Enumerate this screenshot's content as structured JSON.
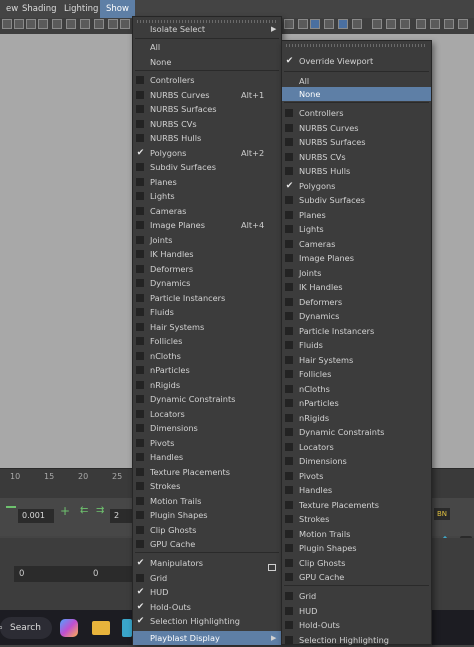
{
  "menubar": {
    "items": [
      "ew",
      "Shading",
      "Lighting",
      "Show"
    ]
  },
  "timeline": {
    "ticks": [
      "10",
      "15",
      "20",
      "25"
    ]
  },
  "range": {
    "step_value": "0.001",
    "frame_value": "2",
    "start_value": "0",
    "end_value": "0",
    "bn_label": "BN"
  },
  "taskbar": {
    "search_label": "Search"
  },
  "show_menu": {
    "header_item": "Isolate Select",
    "items": [
      {
        "label": "All"
      },
      {
        "label": "None"
      },
      {
        "label": "Controllers",
        "checked": false
      },
      {
        "label": "NURBS Curves",
        "accel": "Alt+1",
        "checked": false
      },
      {
        "label": "NURBS Surfaces",
        "checked": false
      },
      {
        "label": "NURBS CVs",
        "checked": false
      },
      {
        "label": "NURBS Hulls",
        "checked": false
      },
      {
        "label": "Polygons",
        "accel": "Alt+2",
        "checked": true
      },
      {
        "label": "Subdiv Surfaces",
        "checked": false
      },
      {
        "label": "Planes",
        "checked": false
      },
      {
        "label": "Lights",
        "checked": false
      },
      {
        "label": "Cameras",
        "checked": false
      },
      {
        "label": "Image Planes",
        "accel": "Alt+4",
        "checked": false
      },
      {
        "label": "Joints",
        "checked": false
      },
      {
        "label": "IK Handles",
        "checked": false
      },
      {
        "label": "Deformers",
        "checked": false
      },
      {
        "label": "Dynamics",
        "checked": false
      },
      {
        "label": "Particle Instancers",
        "checked": false
      },
      {
        "label": "Fluids",
        "checked": false
      },
      {
        "label": "Hair Systems",
        "checked": false
      },
      {
        "label": "Follicles",
        "checked": false
      },
      {
        "label": "nCloths",
        "checked": false
      },
      {
        "label": "nParticles",
        "checked": false
      },
      {
        "label": "nRigids",
        "checked": false
      },
      {
        "label": "Dynamic Constraints",
        "checked": false
      },
      {
        "label": "Locators",
        "checked": false
      },
      {
        "label": "Dimensions",
        "checked": false
      },
      {
        "label": "Pivots",
        "checked": false
      },
      {
        "label": "Handles",
        "checked": false
      },
      {
        "label": "Texture Placements",
        "checked": false
      },
      {
        "label": "Strokes",
        "checked": false
      },
      {
        "label": "Motion Trails",
        "checked": false
      },
      {
        "label": "Plugin Shapes",
        "checked": false
      },
      {
        "label": "Clip Ghosts",
        "checked": false
      },
      {
        "label": "GPU Cache",
        "checked": false
      },
      {
        "label": "Manipulators",
        "checked": true
      },
      {
        "label": "Grid",
        "checked": false
      },
      {
        "label": "HUD",
        "checked": true
      },
      {
        "label": "Hold-Outs",
        "checked": true
      },
      {
        "label": "Selection Highlighting",
        "checked": true
      }
    ],
    "footer_item": "Playblast Display"
  },
  "playblast_menu": {
    "header_item": {
      "label": "Override Viewport",
      "checked": true
    },
    "items": [
      {
        "label": "All"
      },
      {
        "label": "None"
      },
      {
        "label": "Controllers",
        "checked": false
      },
      {
        "label": "NURBS Curves",
        "checked": false
      },
      {
        "label": "NURBS Surfaces",
        "checked": false
      },
      {
        "label": "NURBS CVs",
        "checked": false
      },
      {
        "label": "NURBS Hulls",
        "checked": false
      },
      {
        "label": "Polygons",
        "checked": true
      },
      {
        "label": "Subdiv Surfaces",
        "checked": false
      },
      {
        "label": "Planes",
        "checked": false
      },
      {
        "label": "Lights",
        "checked": false
      },
      {
        "label": "Cameras",
        "checked": false
      },
      {
        "label": "Image Planes",
        "checked": false
      },
      {
        "label": "Joints",
        "checked": false
      },
      {
        "label": "IK Handles",
        "checked": false
      },
      {
        "label": "Deformers",
        "checked": false
      },
      {
        "label": "Dynamics",
        "checked": false
      },
      {
        "label": "Particle Instancers",
        "checked": false
      },
      {
        "label": "Fluids",
        "checked": false
      },
      {
        "label": "Hair Systems",
        "checked": false
      },
      {
        "label": "Follicles",
        "checked": false
      },
      {
        "label": "nCloths",
        "checked": false
      },
      {
        "label": "nParticles",
        "checked": false
      },
      {
        "label": "nRigids",
        "checked": false
      },
      {
        "label": "Dynamic Constraints",
        "checked": false
      },
      {
        "label": "Locators",
        "checked": false
      },
      {
        "label": "Dimensions",
        "checked": false
      },
      {
        "label": "Pivots",
        "checked": false
      },
      {
        "label": "Handles",
        "checked": false
      },
      {
        "label": "Texture Placements",
        "checked": false
      },
      {
        "label": "Strokes",
        "checked": false
      },
      {
        "label": "Motion Trails",
        "checked": false
      },
      {
        "label": "Plugin Shapes",
        "checked": false
      },
      {
        "label": "Clip Ghosts",
        "checked": false
      },
      {
        "label": "GPU Cache",
        "checked": false
      },
      {
        "label": "Grid",
        "checked": false
      },
      {
        "label": "HUD",
        "checked": false
      },
      {
        "label": "Hold-Outs",
        "checked": false
      },
      {
        "label": "Selection Highlighting",
        "checked": false
      }
    ]
  },
  "colors": {
    "highlight": "#5e7fa6",
    "menu_bg": "#3c3c3c",
    "viewport_bg": "#a8a8a8"
  }
}
